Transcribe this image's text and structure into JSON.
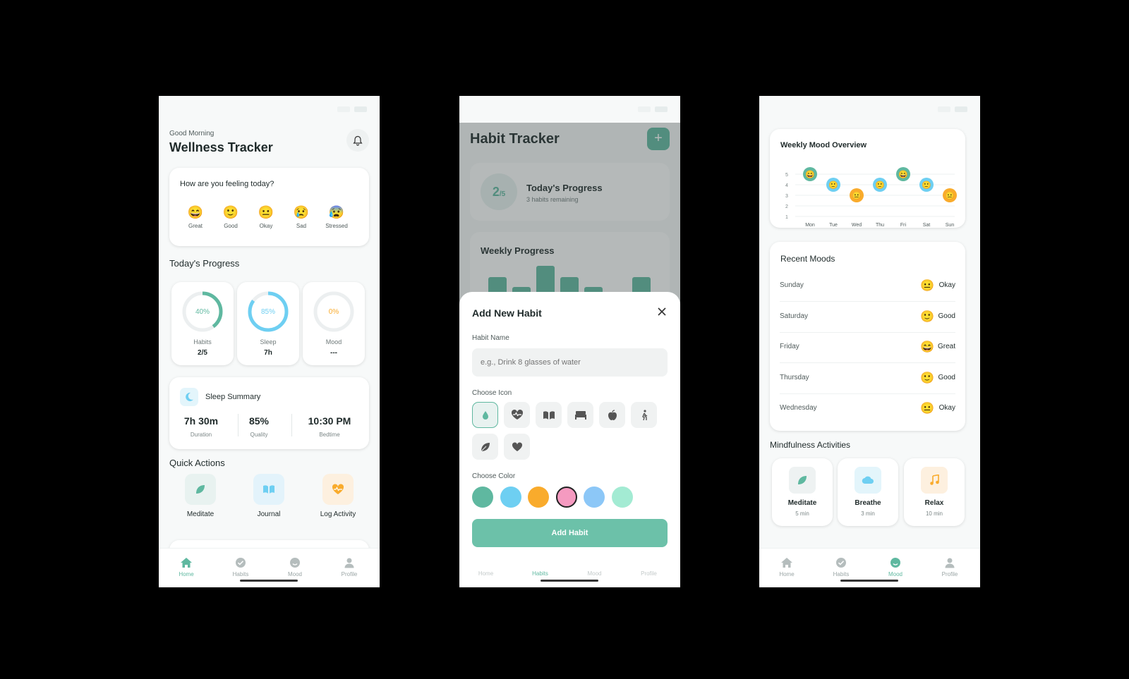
{
  "colors": {
    "teal": "#5fb8a0",
    "blue": "#6ecff2",
    "orange": "#f9ab2c",
    "pink": "#f59ac0",
    "lightblue": "#8cc7f7",
    "mint": "#a3ebd3"
  },
  "home": {
    "greeting": "Good Morning",
    "title": "Wellness Tracker",
    "mood_card": {
      "question": "How are you feeling today?",
      "options": [
        {
          "emoji": "😄",
          "label": "Great"
        },
        {
          "emoji": "🙂",
          "label": "Good"
        },
        {
          "emoji": "😐",
          "label": "Okay"
        },
        {
          "emoji": "😢",
          "label": "Sad"
        },
        {
          "emoji": "😰",
          "label": "Stressed"
        }
      ]
    },
    "progress_title": "Today's Progress",
    "progress": [
      {
        "percent_label": "40%",
        "percent": 40,
        "label": "Habits",
        "value": "2/5"
      },
      {
        "percent_label": "85%",
        "percent": 85,
        "label": "Sleep",
        "value": "7h"
      },
      {
        "percent_label": "0%",
        "percent": 0,
        "label": "Mood",
        "value": "---"
      }
    ],
    "sleep": {
      "title": "Sleep Summary",
      "stats": [
        {
          "value": "7h 30m",
          "label": "Duration"
        },
        {
          "value": "85%",
          "label": "Quality"
        },
        {
          "value": "10:30 PM",
          "label": "Bedtime"
        }
      ]
    },
    "quick_title": "Quick Actions",
    "quick": [
      "Meditate",
      "Journal",
      "Log Activity"
    ]
  },
  "tabs": [
    "Home",
    "Habits",
    "Mood",
    "Profile"
  ],
  "habit": {
    "title": "Habit Tracker",
    "progress": {
      "count": "2",
      "total": "/5",
      "title": "Today's Progress",
      "sub": "3 habits remaining"
    },
    "weekly_title": "Weekly Progress",
    "modal": {
      "title": "Add New Habit",
      "name_label": "Habit Name",
      "name_placeholder": "e.g., Drink 8 glasses of water",
      "icon_label": "Choose Icon",
      "icons": [
        "water-drop-icon",
        "heartbeat-icon",
        "book-icon",
        "bed-icon",
        "apple-icon",
        "walking-icon",
        "leaf-icon",
        "heart-icon"
      ],
      "color_label": "Choose Color",
      "swatches": [
        "#5fb8a0",
        "#6ecff2",
        "#f9ab2c",
        "#f59ac0",
        "#8cc7f7",
        "#a3ebd3"
      ],
      "selected_color": 3,
      "button": "Add Habit"
    }
  },
  "mood": {
    "weekly_title": "Weekly Mood Overview",
    "recent_title": "Recent Moods",
    "recent": [
      {
        "day": "Sunday",
        "emoji": "😐",
        "mood": "Okay"
      },
      {
        "day": "Saturday",
        "emoji": "🙂",
        "mood": "Good"
      },
      {
        "day": "Friday",
        "emoji": "😄",
        "mood": "Great"
      },
      {
        "day": "Thursday",
        "emoji": "🙂",
        "mood": "Good"
      },
      {
        "day": "Wednesday",
        "emoji": "😐",
        "mood": "Okay"
      }
    ],
    "mindful_title": "Mindfulness Activities",
    "activities": [
      {
        "name": "Meditate",
        "duration": "5 min"
      },
      {
        "name": "Breathe",
        "duration": "3 min"
      },
      {
        "name": "Relax",
        "duration": "10 min"
      }
    ]
  },
  "chart_data": {
    "type": "scatter",
    "title": "Weekly Mood Overview",
    "categories": [
      "Mon",
      "Tue",
      "Wed",
      "Thu",
      "Fri",
      "Sat",
      "Sun"
    ],
    "values": [
      5,
      4,
      3,
      4,
      5,
      4,
      3
    ],
    "y_ticks": [
      "1",
      "2",
      "3",
      "4",
      "5"
    ],
    "ylim": [
      1,
      5
    ],
    "grid": true
  }
}
